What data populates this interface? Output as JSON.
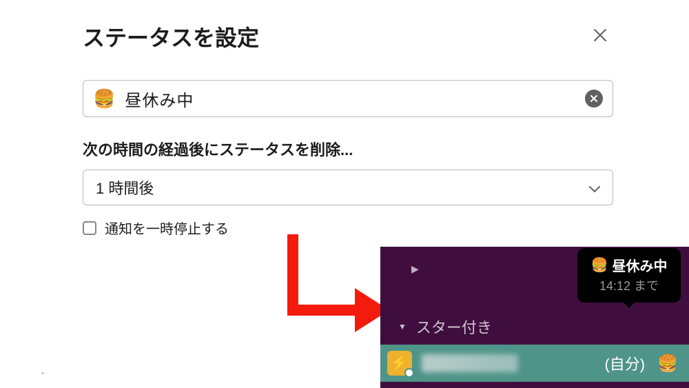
{
  "dialog": {
    "title": "ステータスを設定",
    "status_emoji": "🍔",
    "status_text": "昼休み中",
    "clear_after_label": "次の時間の経過後にステータスを削除...",
    "duration_value": "1 時間後",
    "pause_notifications_label": "通知を一時停止する"
  },
  "sidebar": {
    "section_label": "スター付き",
    "self_label": "(自分)",
    "self_status_emoji": "🍔"
  },
  "tooltip": {
    "emoji": "🍔",
    "status": "昼休み中",
    "until": "14:12 まで"
  }
}
